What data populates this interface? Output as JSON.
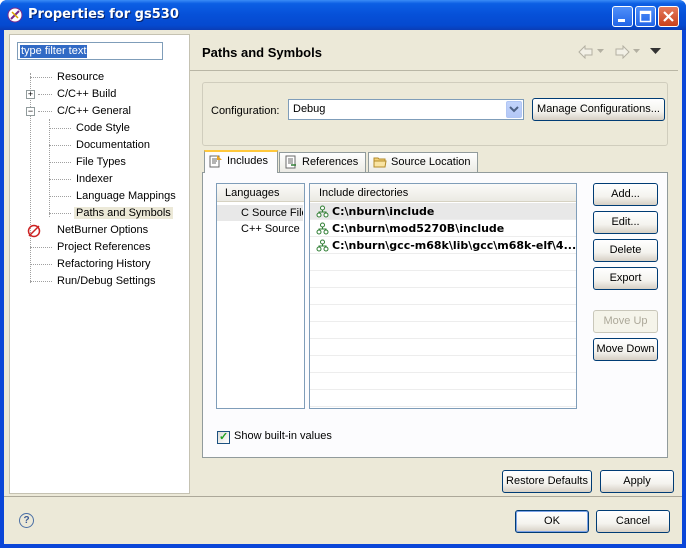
{
  "window": {
    "title": "Properties for gs530"
  },
  "filter": {
    "value": "type filter text"
  },
  "tree": {
    "items": [
      {
        "label": "Resource"
      },
      {
        "label": "C/C++ Build"
      },
      {
        "label": "C/C++ General"
      },
      {
        "label": "Code Style"
      },
      {
        "label": "Documentation"
      },
      {
        "label": "File Types"
      },
      {
        "label": "Indexer"
      },
      {
        "label": "Language Mappings"
      },
      {
        "label": "Paths and Symbols"
      },
      {
        "label": "NetBurner Options"
      },
      {
        "label": "Project References"
      },
      {
        "label": "Refactoring History"
      },
      {
        "label": "Run/Debug Settings"
      }
    ],
    "selected": "Paths and Symbols"
  },
  "page": {
    "title": "Paths and Symbols"
  },
  "configuration": {
    "label": "Configuration:",
    "value": "Debug",
    "manage_label": "Manage Configurations..."
  },
  "tabs": [
    {
      "label": "Includes"
    },
    {
      "label": "References"
    },
    {
      "label": "Source Location"
    }
  ],
  "active_tab": "Includes",
  "languages": {
    "header": "Languages",
    "items": [
      {
        "label": "C Source File"
      },
      {
        "label": "C++ Source"
      }
    ]
  },
  "includes": {
    "header": "Include directories",
    "rows": [
      {
        "path": "C:\\nburn\\include"
      },
      {
        "path": "C:\\nburn\\mod5270B\\include"
      },
      {
        "path": "C:\\nburn\\gcc-m68k\\lib\\gcc\\m68k-elf\\4...."
      }
    ]
  },
  "side_buttons": {
    "add": "Add...",
    "edit": "Edit...",
    "delete": "Delete",
    "export": "Export",
    "move_up": "Move Up",
    "move_down": "Move Down"
  },
  "show_builtin": {
    "label": "Show built-in values",
    "checked": true
  },
  "footer": {
    "restore": "Restore Defaults",
    "apply": "Apply",
    "ok": "OK",
    "cancel": "Cancel"
  },
  "colors": {
    "titlebar": "#0549cf",
    "client": "#ece9d8",
    "selection": "#316ac5"
  }
}
